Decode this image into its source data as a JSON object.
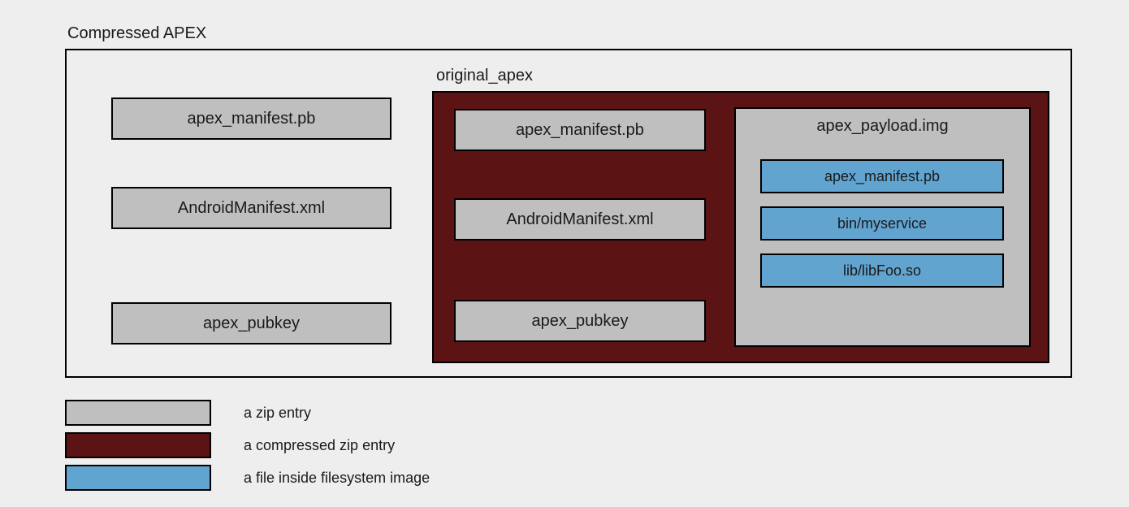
{
  "titles": {
    "outer": "Compressed APEX",
    "original": "original_apex"
  },
  "left_entries": {
    "e0": "apex_manifest.pb",
    "e1": "AndroidManifest.xml",
    "e2": "apex_pubkey"
  },
  "orig_entries": {
    "e0": "apex_manifest.pb",
    "e1": "AndroidManifest.xml",
    "e2": "apex_pubkey"
  },
  "payload": {
    "title": "apex_payload.img",
    "files": {
      "f0": "apex_manifest.pb",
      "f1": "bin/myservice",
      "f2": "lib/libFoo.so"
    }
  },
  "legend": {
    "zip": "a zip entry",
    "compressed": "a compressed zip entry",
    "file": "a file inside filesystem image"
  }
}
